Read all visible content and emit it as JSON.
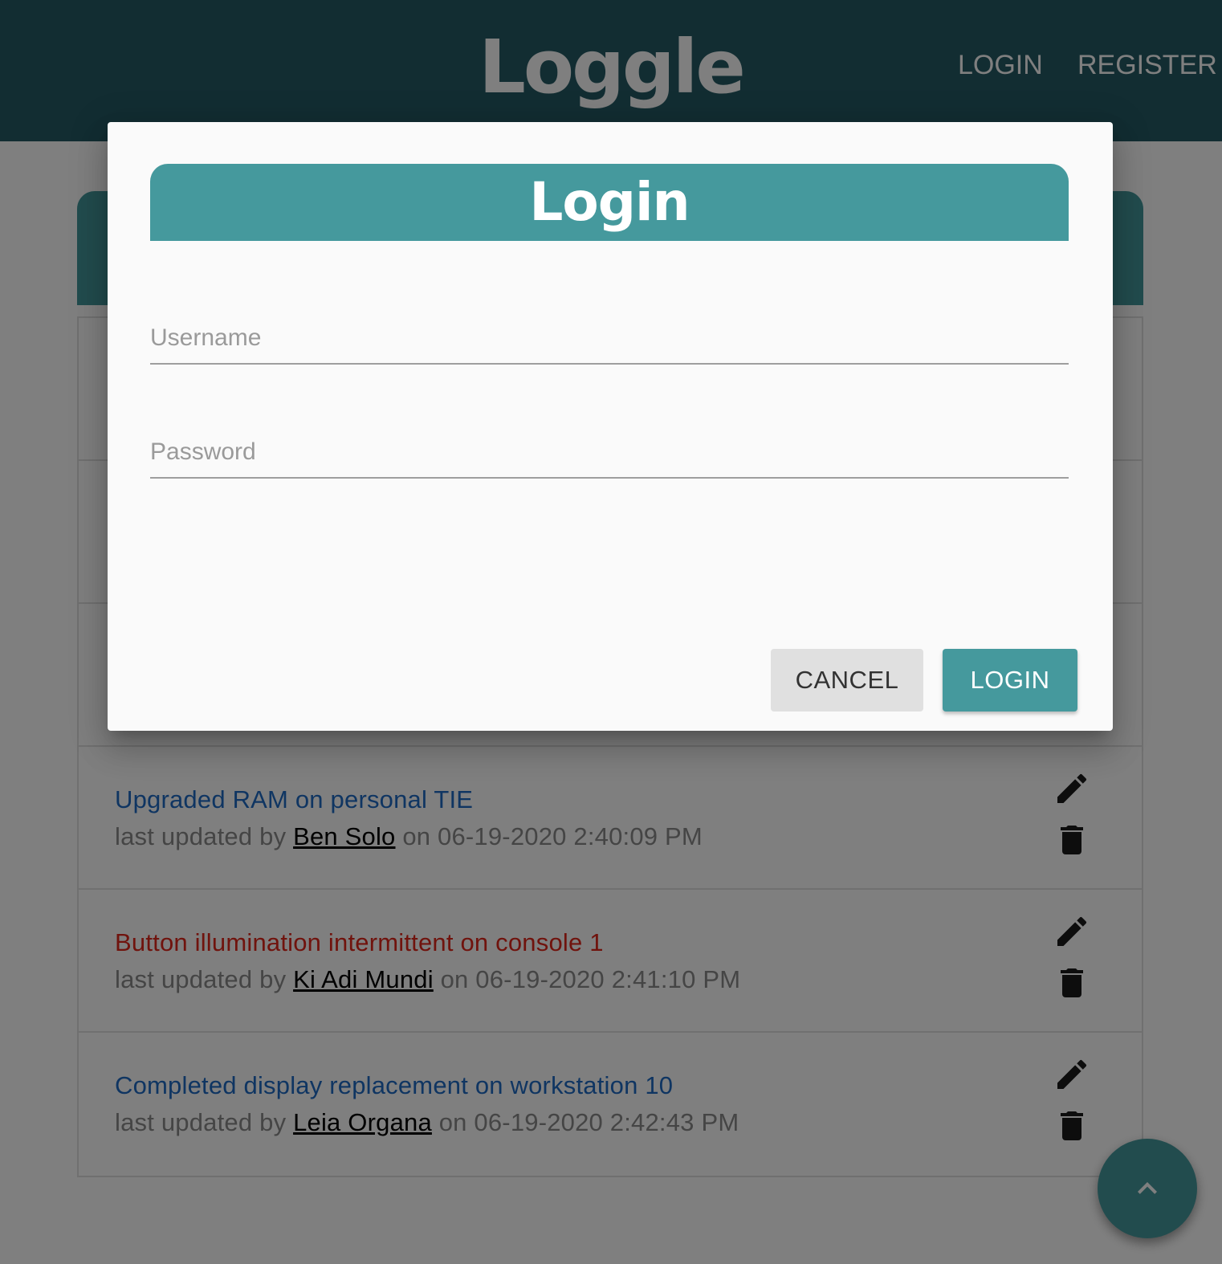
{
  "appbar": {
    "brand": "Loggle",
    "login_label": "LOGIN",
    "register_label": "REGISTER"
  },
  "list": {
    "items": [
      {},
      {},
      {},
      {
        "title": "Upgraded RAM on personal TIE",
        "meta_prefix": "last updated by ",
        "user": "Ben Solo",
        "meta_suffix": " on 06-19-2020 2:40:09 PM",
        "status": "normal"
      },
      {
        "title": "Button illumination intermittent on console 1",
        "meta_prefix": "last updated by ",
        "user": "Ki Adi Mundi",
        "meta_suffix": " on 06-19-2020 2:41:10 PM",
        "status": "alert"
      },
      {
        "title": "Completed display replacement on workstation 10",
        "meta_prefix": "last updated by ",
        "user": "Leia Organa",
        "meta_suffix": " on 06-19-2020 2:42:43 PM",
        "status": "normal"
      }
    ]
  },
  "dialog": {
    "title": "Login",
    "username_placeholder": "Username",
    "password_placeholder": "Password",
    "cancel_label": "CANCEL",
    "login_label": "LOGIN"
  },
  "colors": {
    "appbar": "#245a64",
    "accent": "#45999d",
    "link": "#1f6bc4",
    "alert": "#e0261b"
  },
  "icons": {
    "edit": "pencil-icon",
    "delete": "trash-icon",
    "scroll_top": "chevron-up-icon"
  }
}
